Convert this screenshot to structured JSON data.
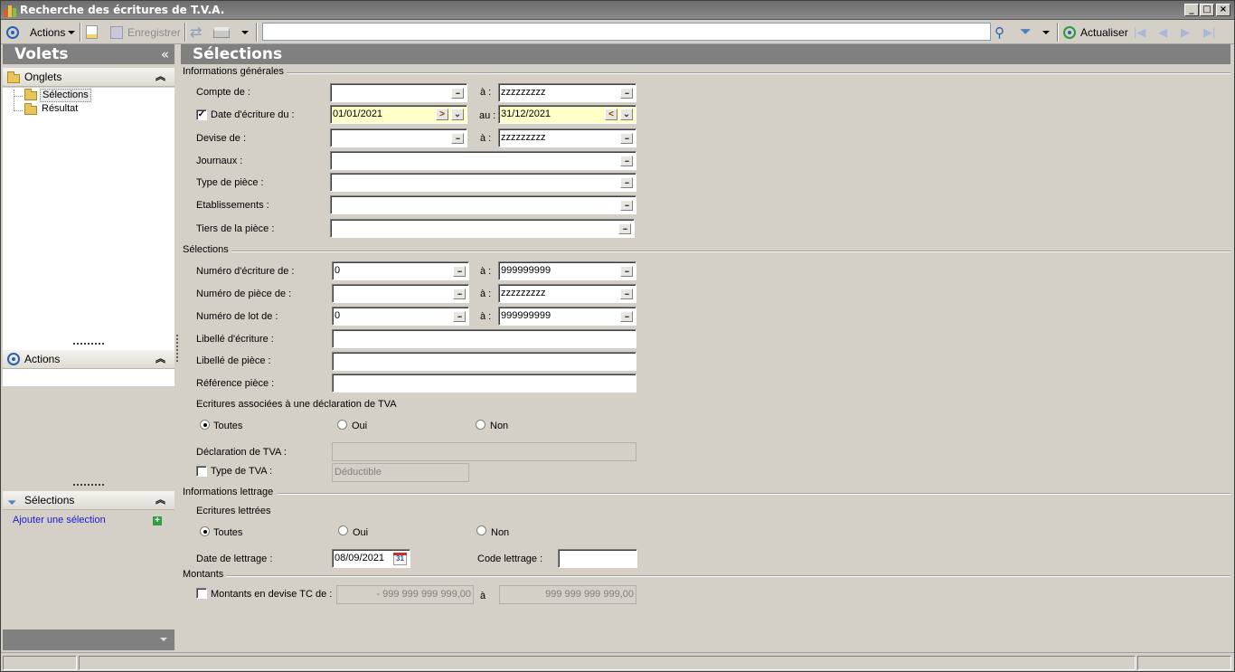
{
  "window": {
    "title": "Recherche des écritures de T.V.A."
  },
  "toolbar": {
    "actions_label": "Actions",
    "save_label": "Enregistrer",
    "search_value": "",
    "refresh_label": "Actualiser"
  },
  "left": {
    "volets_title": "Volets",
    "onglets_title": "Onglets",
    "tree": [
      "Sélections",
      "Résultat"
    ],
    "actions_title": "Actions",
    "selections_title": "Sélections",
    "add_selection": "Ajouter une sélection"
  },
  "main": {
    "title": "Sélections",
    "general": {
      "group_title": "Informations générales",
      "compte_label": "Compte de :",
      "compte_from": "",
      "compte_to_label": "à :",
      "compte_to": "zzzzzzzzz",
      "date_label": "Date d'écriture du :",
      "date_checked": true,
      "date_from": "01/01/2021",
      "date_to_label": "au :",
      "date_to": "31/12/2021",
      "devise_label": "Devise de :",
      "devise_from": "",
      "devise_to_label": "à :",
      "devise_to": "zzzzzzzzz",
      "journaux_label": "Journaux :",
      "type_piece_label": "Type de pièce :",
      "etab_label": "Etablissements :",
      "tiers_label": "Tiers de la pièce :"
    },
    "selections": {
      "group_title": "Sélections",
      "num_ecr_label": "Numéro d'écriture de :",
      "num_ecr_from": "0",
      "num_ecr_to_label": "à :",
      "num_ecr_to": "999999999",
      "num_piece_label": "Numéro de pièce de :",
      "num_piece_from": "",
      "num_piece_to_label": "à :",
      "num_piece_to": "zzzzzzzzz",
      "num_lot_label": "Numéro de lot de :",
      "num_lot_from": "0",
      "num_lot_to_label": "à :",
      "num_lot_to": "999999999",
      "libelle_ecr_label": "Libellé d'écriture :",
      "libelle_piece_label": "Libellé de pièce :",
      "ref_piece_label": "Référence pièce :",
      "assoc_label": "Ecritures associées à une déclaration de TVA",
      "assoc_opts": [
        "Toutes",
        "Oui",
        "Non"
      ],
      "decl_label": "Déclaration de TVA :",
      "type_tva_label": "Type de TVA :",
      "type_tva_checked": false,
      "type_tva_value": "Déductible"
    },
    "lettrage": {
      "group_title": "Informations lettrage",
      "ecr_lettrees_label": "Ecritures lettrées",
      "opts": [
        "Toutes",
        "Oui",
        "Non"
      ],
      "date_label": "Date de lettrage :",
      "date_value": "08/09/2021",
      "calendar_day": "31",
      "code_label": "Code lettrage :"
    },
    "montants": {
      "group_title": "Montants",
      "label": "Montants en devise TC de :",
      "checked": false,
      "from": "- 999 999 999 999,00",
      "to_label": "à",
      "to": "999 999 999 999,00"
    }
  }
}
